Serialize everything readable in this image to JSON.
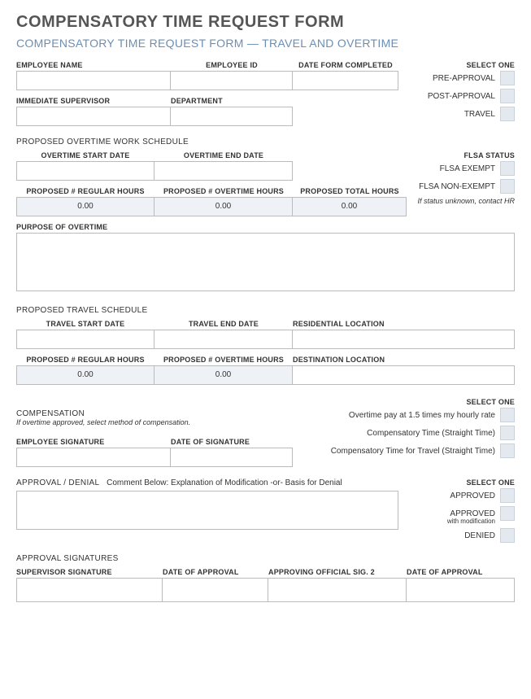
{
  "title": "COMPENSATORY TIME REQUEST FORM",
  "subtitle": "COMPENSATORY TIME REQUEST FORM — TRAVEL AND OVERTIME",
  "employee": {
    "name_label": "EMPLOYEE NAME",
    "id_label": "EMPLOYEE ID",
    "date_label": "DATE FORM COMPLETED",
    "supervisor_label": "IMMEDIATE SUPERVISOR",
    "department_label": "DEPARTMENT"
  },
  "select_one_label": "SELECT ONE",
  "approval_type": {
    "pre": "PRE-APPROVAL",
    "post": "POST-APPROVAL",
    "travel": "TRAVEL"
  },
  "overtime": {
    "heading": "PROPOSED OVERTIME WORK SCHEDULE",
    "start_label": "OVERTIME START DATE",
    "end_label": "OVERTIME END DATE",
    "reg_hours_label": "PROPOSED # REGULAR HOURS",
    "ot_hours_label": "PROPOSED # OVERTIME HOURS",
    "total_hours_label": "PROPOSED TOTAL HOURS",
    "reg_hours_value": "0.00",
    "ot_hours_value": "0.00",
    "total_hours_value": "0.00"
  },
  "flsa": {
    "heading": "FLSA STATUS",
    "exempt": "FLSA EXEMPT",
    "nonexempt": "FLSA NON-EXEMPT",
    "note": "If status unknown, contact HR"
  },
  "purpose_label": "PURPOSE OF OVERTIME",
  "travel": {
    "heading": "PROPOSED TRAVEL SCHEDULE",
    "start_label": "TRAVEL START DATE",
    "end_label": "TRAVEL END DATE",
    "res_label": "RESIDENTIAL LOCATION",
    "reg_hours_label": "PROPOSED # REGULAR HOURS",
    "ot_hours_label": "PROPOSED # OVERTIME HOURS",
    "dest_label": "DESTINATION LOCATION",
    "reg_hours_value": "0.00",
    "ot_hours_value": "0.00"
  },
  "compensation": {
    "heading": "COMPENSATION",
    "note": "If overtime approved, select method of compensation.",
    "opt1": "Overtime pay at 1.5 times my hourly rate",
    "opt2": "Compensatory Time (Straight Time)",
    "opt3": "Compensatory Time for Travel (Straight Time)",
    "sig_label": "EMPLOYEE SIGNATURE",
    "sig_date_label": "DATE OF SIGNATURE"
  },
  "approval": {
    "heading": "APPROVAL / DENIAL",
    "comment_note": "Comment Below: Explanation of Modification -or- Basis for Denial",
    "approved": "APPROVED",
    "approved_mod": "APPROVED",
    "approved_mod_sub": "with modification",
    "denied": "DENIED"
  },
  "signatures": {
    "heading": "APPROVAL SIGNATURES",
    "sup_sig": "SUPERVISOR SIGNATURE",
    "sup_date": "DATE OF APPROVAL",
    "off_sig": "APPROVING OFFICIAL SIG. 2",
    "off_date": "DATE OF APPROVAL"
  }
}
